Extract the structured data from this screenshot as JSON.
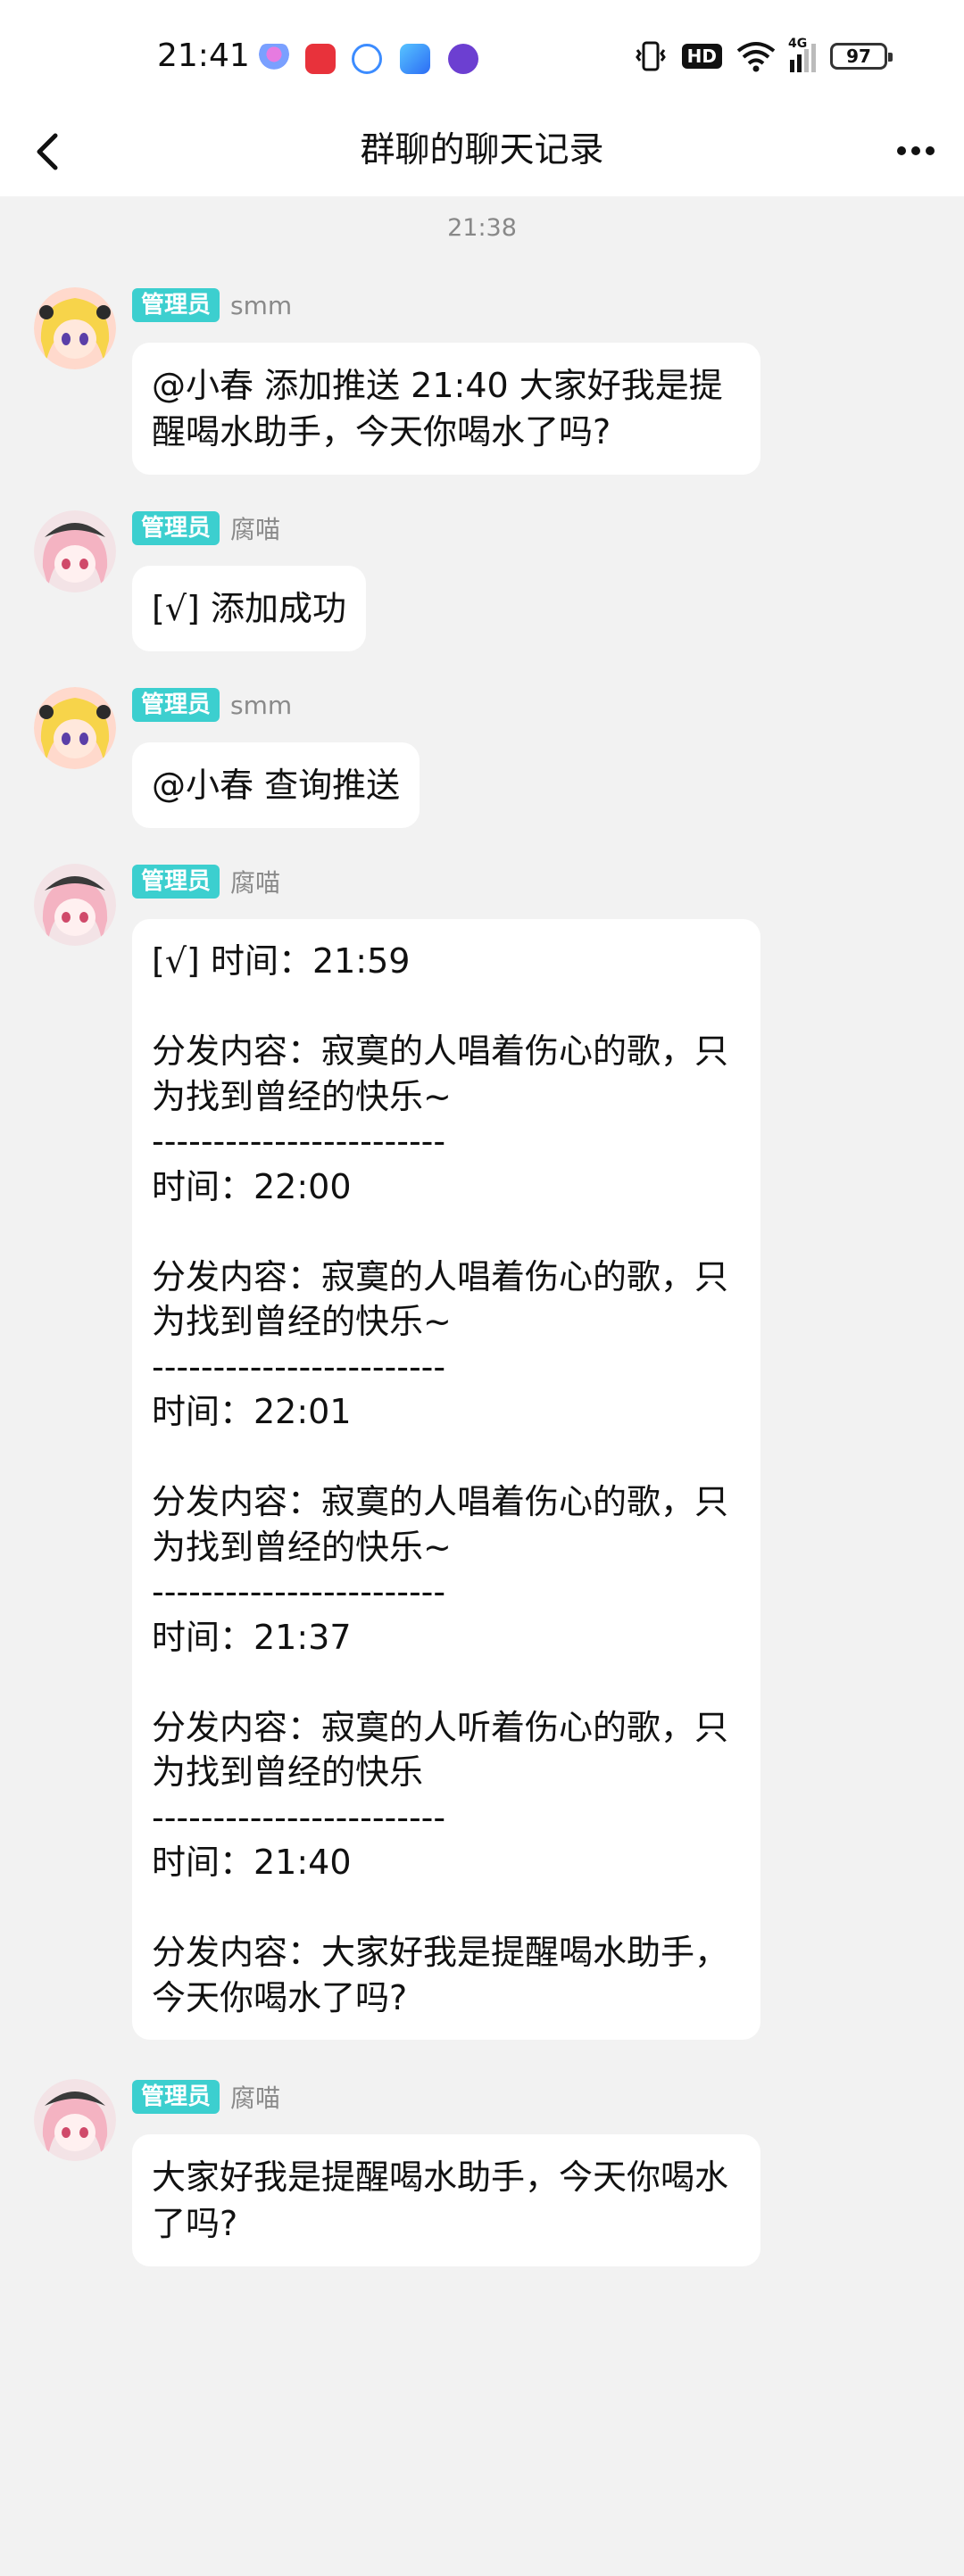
{
  "status_bar": {
    "time": "21:41",
    "network": "HD",
    "signal_label": "4G",
    "battery": "97"
  },
  "title_bar": {
    "title": "群聊的聊天记录"
  },
  "timestamp": "21:38",
  "colors": {
    "badge": "#3ccfcf",
    "bubble": "#ffffff",
    "background": "#f2f2f2"
  },
  "messages": [
    {
      "badge": "管理员",
      "sender": "smm",
      "avatar": "blonde-girl-avatar",
      "text": "@小春 添加推送 21:40 大家好我是提醒喝水助手，今天你喝水了吗?"
    },
    {
      "badge": "管理员",
      "sender": "腐喵",
      "avatar": "pink-hair-girl-avatar",
      "text": "[√] 添加成功"
    },
    {
      "badge": "管理员",
      "sender": "smm",
      "avatar": "blonde-girl-avatar",
      "text": "@小春 查询推送"
    },
    {
      "badge": "管理员",
      "sender": "腐喵",
      "avatar": "pink-hair-girl-avatar",
      "text": "[√] 时间：21:59\n\n分发内容：寂寞的人唱着伤心的歌，只为找到曾经的快乐~\n------------------------\n时间：22:00\n\n分发内容：寂寞的人唱着伤心的歌，只为找到曾经的快乐~\n------------------------\n时间：22:01\n\n分发内容：寂寞的人唱着伤心的歌，只为找到曾经的快乐~\n------------------------\n时间：21:37\n\n分发内容：寂寞的人听着伤心的歌，只为找到曾经的快乐\n------------------------\n时间：21:40\n\n分发内容：大家好我是提醒喝水助手，今天你喝水了吗?"
    },
    {
      "badge": "管理员",
      "sender": "腐喵",
      "avatar": "pink-hair-girl-avatar",
      "text": "大家好我是提醒喝水助手，今天你喝水了吗?"
    }
  ]
}
